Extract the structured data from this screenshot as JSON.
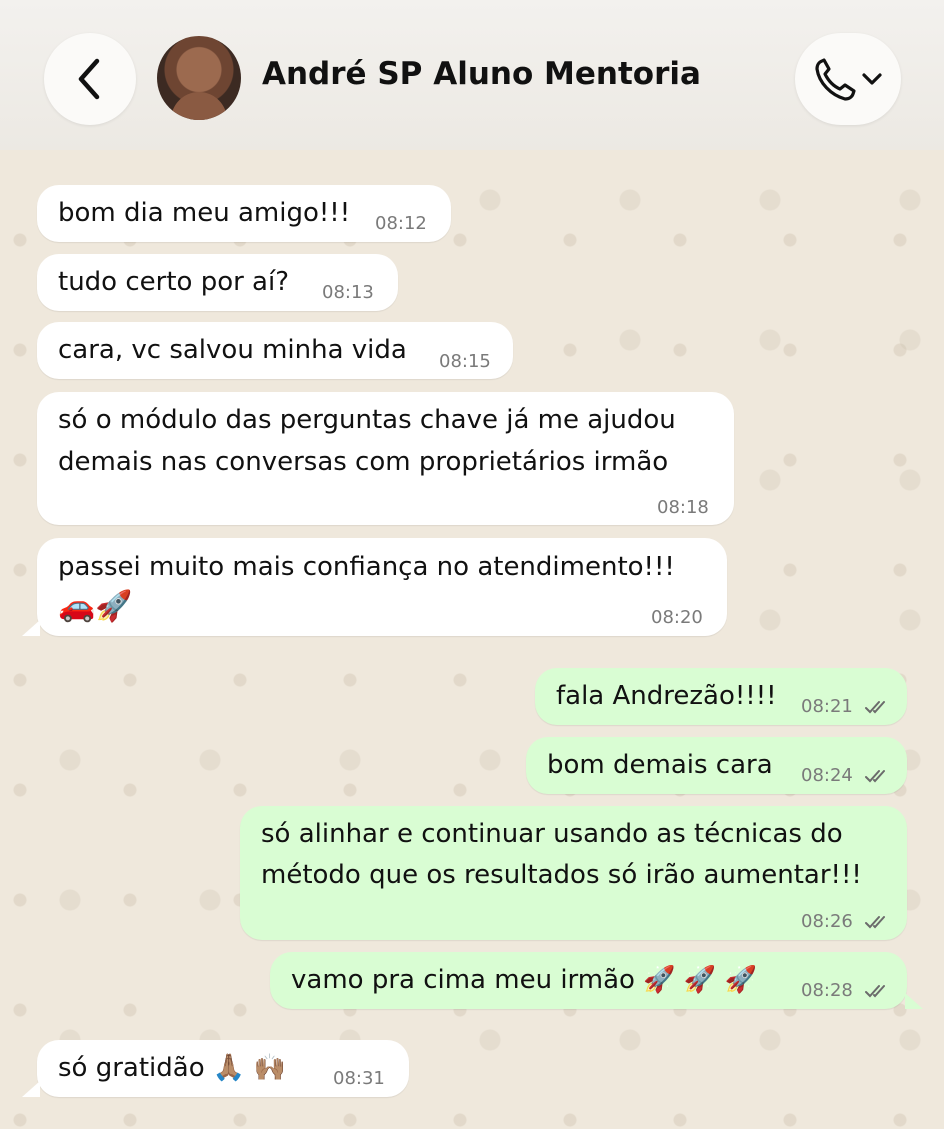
{
  "header": {
    "back_icon": "chevron-left-icon",
    "contact_name": "André SP Aluno Mentoria",
    "call_icon": "phone-icon",
    "dropdown_icon": "chevron-down-icon"
  },
  "messages": [
    {
      "direction": "in",
      "text": "bom dia meu amigo!!!",
      "time": "08:12"
    },
    {
      "direction": "in",
      "text": "tudo certo por aí?",
      "time": "08:13"
    },
    {
      "direction": "in",
      "text": "cara, vc salvou minha vida",
      "time": "08:15"
    },
    {
      "direction": "in",
      "lines": [
        "só o módulo das perguntas chave já me ajudou",
        "demais nas conversas com proprietários irmão"
      ],
      "time": "08:18"
    },
    {
      "direction": "in",
      "lines": [
        "passei muito mais confiança no atendimento!!!",
        "🚗🚀"
      ],
      "time": "08:20"
    },
    {
      "direction": "out",
      "text": "fala Andrezão!!!!",
      "time": "08:21",
      "status": "read"
    },
    {
      "direction": "out",
      "text": "bom demais cara",
      "time": "08:24",
      "status": "read"
    },
    {
      "direction": "out",
      "lines": [
        "só alinhar e continuar usando as técnicas do",
        "método que os resultados só irão aumentar!!!"
      ],
      "time": "08:26",
      "status": "read"
    },
    {
      "direction": "out",
      "text": "vamo pra cima meu irmão 🚀 🚀 🚀",
      "time": "08:28",
      "status": "read"
    },
    {
      "direction": "in",
      "text": "só gratidão 🙏🏽 🙌🏽",
      "time": "08:31"
    }
  ],
  "colors": {
    "incoming_bubble": "#ffffff",
    "outgoing_bubble": "#d9fdd3",
    "wallpaper": "#efe8dc",
    "read_ticks": "#6b6b6b"
  }
}
